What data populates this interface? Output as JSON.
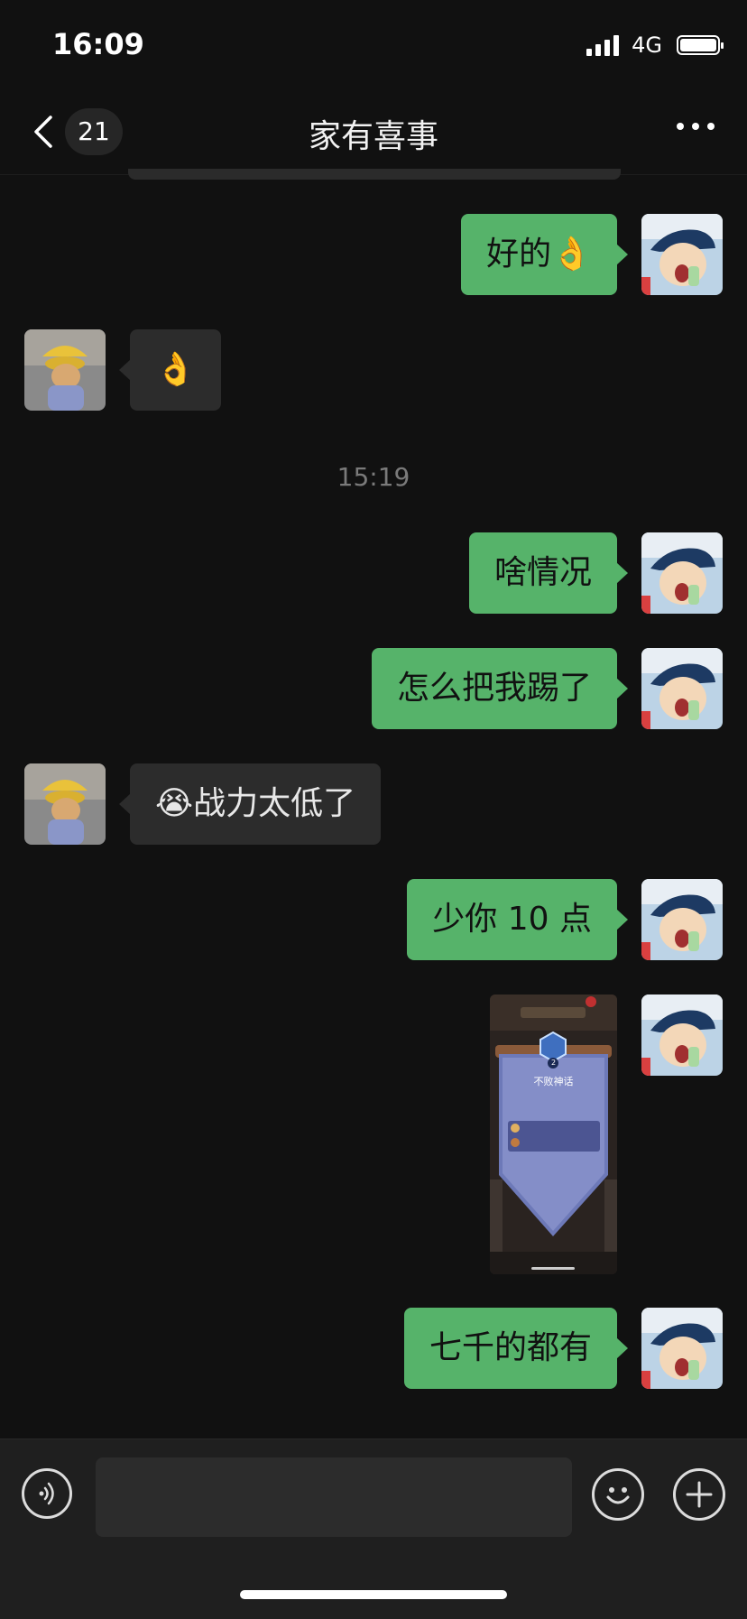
{
  "status_bar": {
    "time": "16:09",
    "network": "4G"
  },
  "nav": {
    "unread_count": "21",
    "title": "家有喜事"
  },
  "timestamp": "15:19",
  "messages": [
    {
      "sender": "me",
      "text": "好的👌"
    },
    {
      "sender": "other",
      "text": "👌"
    },
    {
      "sender": "me",
      "text": "啥情况"
    },
    {
      "sender": "me",
      "text": "怎么把我踢了"
    },
    {
      "sender": "other",
      "text": "😭战力太低了"
    },
    {
      "sender": "me",
      "text": "少你 10 点"
    },
    {
      "sender": "me",
      "type": "image",
      "image_title": "不败神话",
      "image_badge": "2"
    },
    {
      "sender": "me",
      "text": "七千的都有"
    }
  ],
  "input": {
    "placeholder": ""
  },
  "icons": {
    "back": "chevron-left-icon",
    "more": "more-icon",
    "voice": "voice-icon",
    "emoji": "emoji-icon",
    "plus": "plus-icon"
  },
  "colors": {
    "background": "#111111",
    "my_bubble": "#56b36a",
    "other_bubble": "#2c2c2c"
  }
}
